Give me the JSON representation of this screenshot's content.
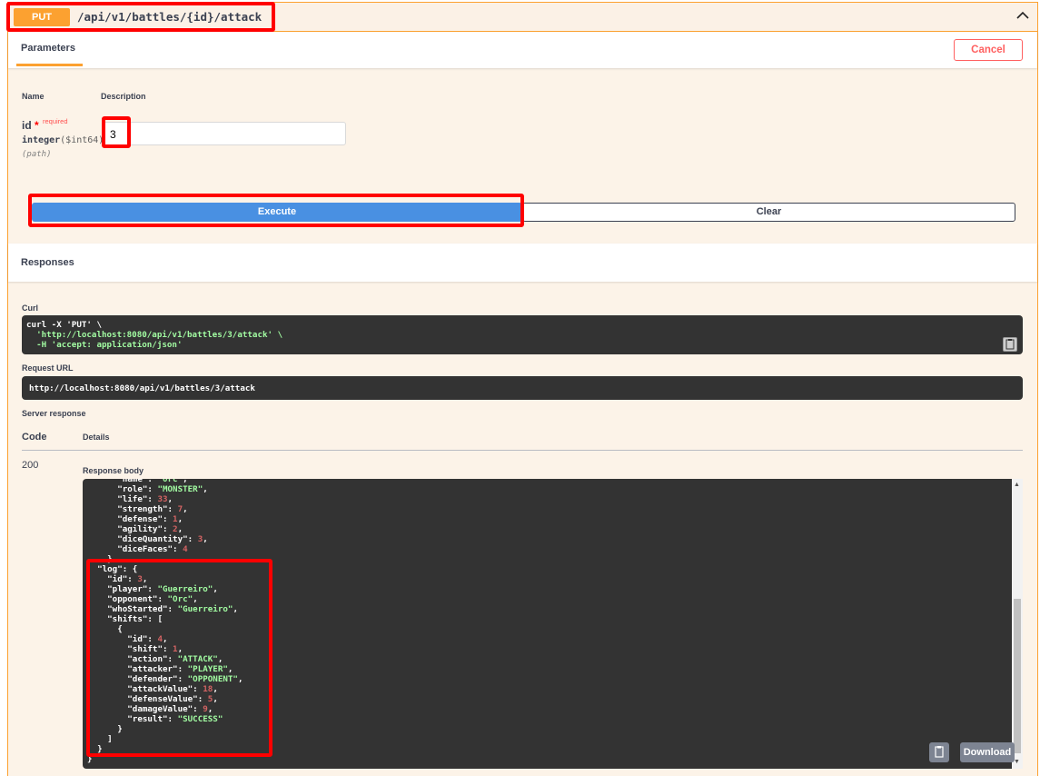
{
  "operation": {
    "method": "PUT",
    "path": "/api/v1/battles/{id}/attack"
  },
  "tabs": {
    "parameters": "Parameters",
    "cancel": "Cancel"
  },
  "params_table": {
    "name_header": "Name",
    "description_header": "Description"
  },
  "param": {
    "name": "id",
    "star": "*",
    "required": "required",
    "type": "integer",
    "format": "($int64)",
    "in": "(path)",
    "value": "3"
  },
  "buttons": {
    "execute": "Execute",
    "clear": "Clear",
    "download": "Download"
  },
  "responses": {
    "title": "Responses",
    "curl_label": "Curl",
    "curl_lines": [
      "curl -X 'PUT' \\",
      "  'http://localhost:8080/api/v1/battles/3/attack' \\",
      "  -H 'accept: application/json'"
    ],
    "request_url_label": "Request URL",
    "request_url": "http://localhost:8080/api/v1/battles/3/attack",
    "server_response_label": "Server response",
    "code_header": "Code",
    "details_header": "Details",
    "code": "200",
    "response_body_label": "Response body"
  },
  "response_body_lines": [
    "      \"name\": \"Orc\",",
    "      \"role\": \"MONSTER\",",
    "      \"life\": 33,",
    "      \"strength\": 7,",
    "      \"defense\": 1,",
    "      \"agility\": 2,",
    "      \"diceQuantity\": 3,",
    "      \"diceFaces\": 4",
    "    },",
    "  \"log\": {",
    "    \"id\": 3,",
    "    \"player\": \"Guerreiro\",",
    "    \"opponent\": \"Orc\",",
    "    \"whoStarted\": \"Guerreiro\",",
    "    \"shifts\": [",
    "      {",
    "        \"id\": 4,",
    "        \"shift\": 1,",
    "        \"action\": \"ATTACK\",",
    "        \"attacker\": \"PLAYER\",",
    "        \"defender\": \"OPPONENT\",",
    "        \"attackValue\": 18,",
    "        \"defenseValue\": 5,",
    "        \"damageValue\": 9,",
    "        \"result\": \"SUCCESS\"",
    "      }",
    "    ]",
    "  }",
    "}"
  ],
  "icons": [
    "chevron-up-icon",
    "copy-icon"
  ],
  "colors": {
    "put": "#fca130",
    "execute": "#4990e2",
    "cancel": "#ff6060",
    "highlight": "#ff0000"
  }
}
